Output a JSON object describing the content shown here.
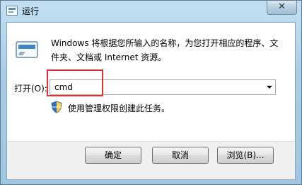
{
  "window": {
    "title": "运行",
    "close_label": "✕"
  },
  "dialog": {
    "description": "Windows 将根据您所输入的名称，为您打开相应的程序、文件夹、文档或 Internet 资源。",
    "open_label": "打开(O):",
    "open_value": "cmd",
    "admin_note": "使用管理权限创建此任务。"
  },
  "buttons": {
    "ok": "确定",
    "cancel": "取消",
    "browse": "浏览(B)..."
  },
  "colors": {
    "highlight": "#e03030",
    "title_bar": "#a9cde6"
  }
}
